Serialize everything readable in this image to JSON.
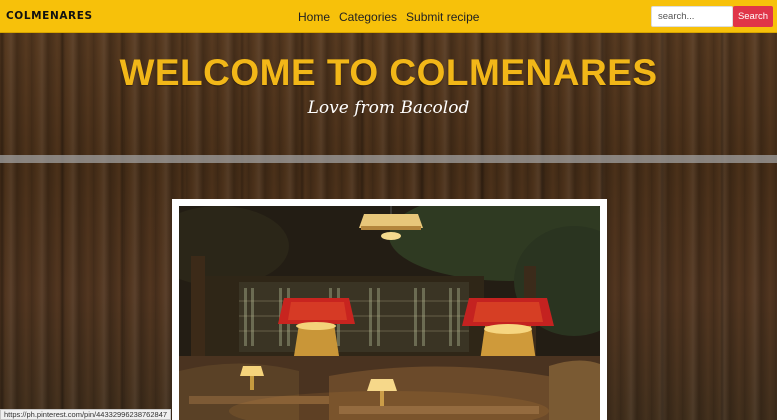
{
  "navbar": {
    "brand": "COLMENARES",
    "links": [
      "Home",
      "Categories",
      "Submit recipe"
    ],
    "search": {
      "placeholder": "search...",
      "button_label": "Search"
    }
  },
  "hero": {
    "title": "WELCOME TO COLMENARES",
    "subtitle": "Love from Bacolod"
  },
  "status_bar": {
    "url": "https://ph.pinterest.com/pin/44332996238762847"
  },
  "colors": {
    "navbar_bg": "#f7c10a",
    "search_button": "#e03548",
    "title": "#f2b718"
  },
  "icons": [
    "restaurant-photo"
  ]
}
